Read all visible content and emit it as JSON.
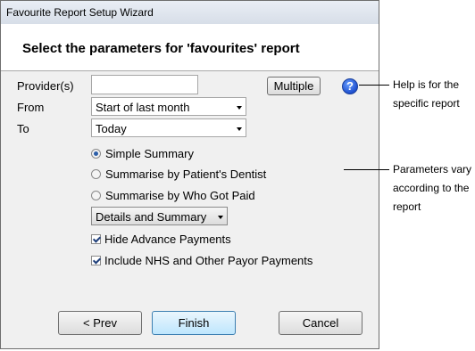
{
  "window": {
    "title": "Favourite Report Setup Wizard"
  },
  "header": {
    "heading": "Select the parameters for 'favourites' report"
  },
  "form": {
    "provider_label": "Provider(s)",
    "provider_value": "",
    "multiple_button": "Multiple",
    "from_label": "From",
    "from_value": "Start of last month",
    "to_label": "To",
    "to_value": "Today",
    "radios": [
      {
        "label": "Simple Summary",
        "selected": true
      },
      {
        "label": "Summarise by Patient's Dentist",
        "selected": false
      },
      {
        "label": "Summarise by Who Got Paid",
        "selected": false
      }
    ],
    "detail_select": "Details and Summary",
    "checkboxes": [
      {
        "label": "Hide Advance Payments",
        "checked": true
      },
      {
        "label": "Include NHS and Other Payor Payments",
        "checked": true
      }
    ]
  },
  "footer": {
    "prev": "< Prev",
    "finish": "Finish",
    "cancel": "Cancel"
  },
  "help_icon": {
    "icon": "help-icon",
    "glyph": "?"
  },
  "annotations": {
    "help_note": [
      "Help is for the",
      "specific report"
    ],
    "params_note": [
      "Parameters vary",
      "according to the",
      "report"
    ]
  }
}
